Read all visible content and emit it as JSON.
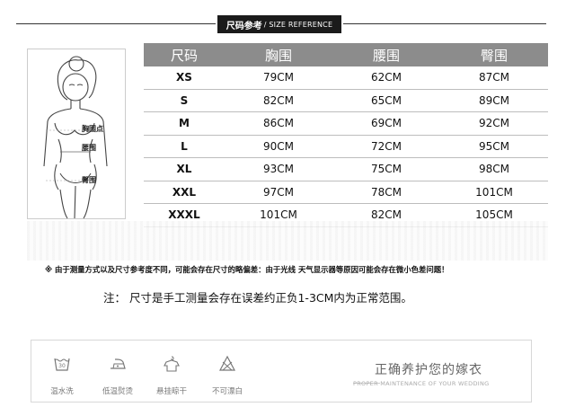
{
  "header": {
    "title": "尺码参考",
    "subtitle": "/ SIZE REFERENCE"
  },
  "figure": {
    "labels": {
      "chest": "胸围点",
      "waist": "腰围",
      "arm": "臀围"
    }
  },
  "table": {
    "headers": [
      "尺码",
      "胸围",
      "腰围",
      "臀围"
    ],
    "rows": [
      [
        "XS",
        "79CM",
        "62CM",
        "87CM"
      ],
      [
        "S",
        "82CM",
        "65CM",
        "89CM"
      ],
      [
        "M",
        "86CM",
        "69CM",
        "92CM"
      ],
      [
        "L",
        "90CM",
        "72CM",
        "95CM"
      ],
      [
        "XL",
        "93CM",
        "75CM",
        "98CM"
      ],
      [
        "XXL",
        "97CM",
        "78CM",
        "101CM"
      ],
      [
        "XXXL",
        "101CM",
        "82CM",
        "105CM"
      ]
    ]
  },
  "notes": {
    "measurement_note": "※ 由于测量方式以及尺寸参考度不同，可能会存在尺寸的略偏差：由于光线 天气显示器等原因可能会存在微小色差问题！",
    "tolerance_note": "注： 尺寸是手工测量会存在误差约正负1-3CM内为正常范围。"
  },
  "care": {
    "items": [
      {
        "icon": "wash-30-icon",
        "label": "温水洗"
      },
      {
        "icon": "low-iron-icon",
        "label": "低温熨烫"
      },
      {
        "icon": "hang-dry-icon",
        "label": "悬挂晾干"
      },
      {
        "icon": "no-bleach-icon",
        "label": "不可漂白"
      }
    ],
    "title": "正确养护您的嫁衣",
    "subtitle": "PROPER MAINTENANCE OF YOUR WEDDING"
  }
}
